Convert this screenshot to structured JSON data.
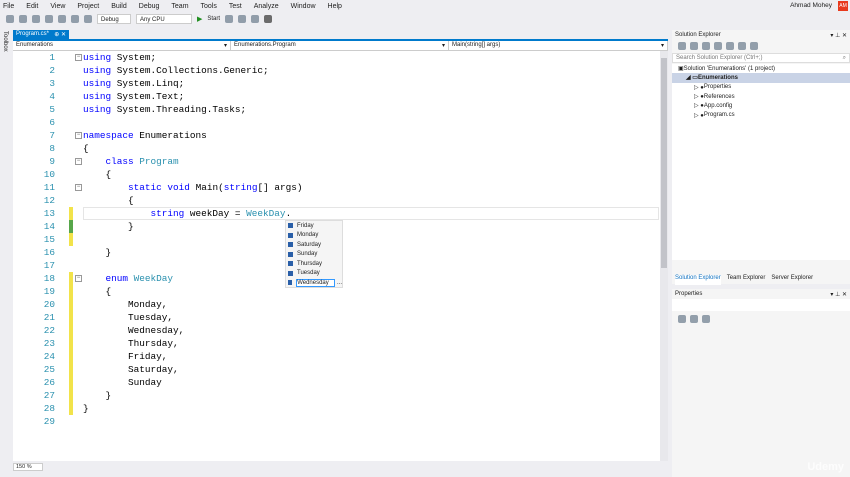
{
  "menu": [
    "File",
    "Edit",
    "View",
    "Project",
    "Build",
    "Debug",
    "Team",
    "Tools",
    "Test",
    "Analyze",
    "Window",
    "Help"
  ],
  "user": {
    "name": "Ahmad Mohey",
    "initials": "AM"
  },
  "toolbar": {
    "config": "Debug",
    "platform": "Any CPU",
    "start": "Start"
  },
  "toolbox": "Toolbox",
  "tab": {
    "label": "Program.cs*",
    "pin": "⊕",
    "close": "✕"
  },
  "nav": {
    "project": "Enumerations",
    "class": "Enumerations.Program",
    "member": "Main(string[] args)"
  },
  "code": [
    "using System;",
    "using System.Collections.Generic;",
    "using System.Linq;",
    "using System.Text;",
    "using System.Threading.Tasks;",
    "",
    "namespace Enumerations",
    "{",
    "    class Program",
    "    {",
    "        static void Main(string[] args)",
    "        {",
    "            string weekDay = WeekDay.",
    "        }",
    "",
    "    }",
    "",
    "    enum WeekDay",
    "    {",
    "        Monday,",
    "        Tuesday,",
    "        Wednesday,",
    "        Thursday,",
    "        Friday,",
    "        Saturday,",
    "        Sunday",
    "    }",
    "}",
    ""
  ],
  "completion": {
    "items": [
      "Friday",
      "Monday",
      "Saturday",
      "Sunday",
      "Thursday",
      "Tuesday",
      "Wednesday"
    ],
    "selected": "Wednesday",
    "more": "..."
  },
  "status": {
    "zoom": "150 %"
  },
  "solution_explorer": {
    "title": "Solution Explorer",
    "search_placeholder": "Search Solution Explorer (Ctrl+;)",
    "tree": [
      {
        "label": "Solution 'Enumerations' (1 project)",
        "level": 0
      },
      {
        "label": "Enumerations",
        "level": 1,
        "selected": true
      },
      {
        "label": "Properties",
        "level": 2
      },
      {
        "label": "References",
        "level": 2
      },
      {
        "label": "App.config",
        "level": 2
      },
      {
        "label": "Program.cs",
        "level": 2
      }
    ],
    "tabs": [
      "Solution Explorer",
      "Team Explorer",
      "Server Explorer"
    ]
  },
  "properties": {
    "title": "Properties"
  },
  "watermark": "Udemy",
  "colors": {
    "accent": "#007acc",
    "keyword": "#0000ff",
    "type": "#2b91af"
  }
}
